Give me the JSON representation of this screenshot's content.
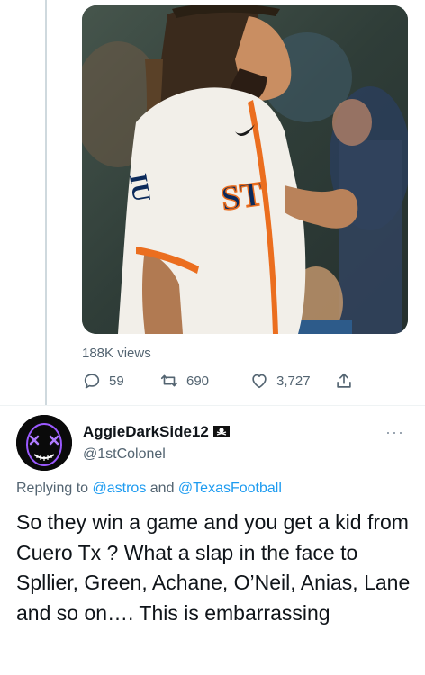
{
  "media": {
    "jersey_text": "ST",
    "sleeve_text": "IU"
  },
  "tweet": {
    "views": "188K views",
    "replies": "59",
    "retweets": "690",
    "likes": "3,727"
  },
  "reply": {
    "display_name": "AggieDarkSide12",
    "handle": "@1stColonel",
    "replying_prefix": "Replying to",
    "mention_1": "@astros",
    "and_word": "and",
    "mention_2": "@TexasFootball",
    "text": "So they win a game and you get a kid from Cuero Tx ? What a slap in the face to Spllier, Green, Achane, O’Neil, Anias, Lane and so on…. This is embarrassing"
  },
  "icons": {
    "reply": "comment-bubble-icon",
    "retweet": "retweet-arrows-icon",
    "like": "heart-outline-icon",
    "share": "share-upload-icon",
    "more": "more-dots-icon",
    "flag": "pirate-flag-icon"
  },
  "colors": {
    "link": "#1d9bf0",
    "secondary_text": "#536471",
    "primary_text": "#0f1419",
    "jersey_orange": "#eb6e1f"
  }
}
